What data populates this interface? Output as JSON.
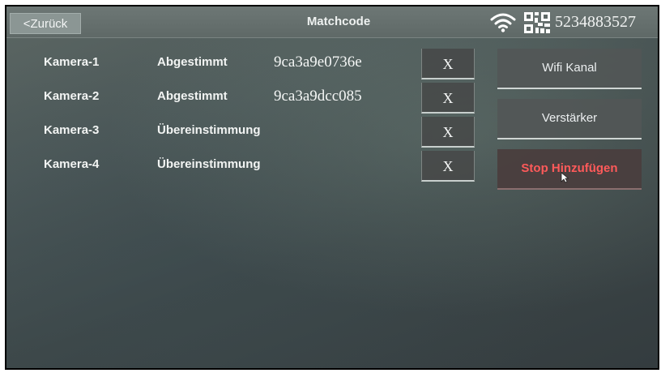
{
  "header": {
    "back_label": "<Zurück",
    "title": "Matchcode",
    "device_id": "5234883527",
    "icons": [
      "wifi-icon",
      "qr-code-icon"
    ]
  },
  "cameras": [
    {
      "name": "Kamera-1",
      "status": "Abgestimmt",
      "code": "9ca3a9e0736e",
      "remove_label": "X"
    },
    {
      "name": "Kamera-2",
      "status": "Abgestimmt",
      "code": "9ca3a9dcc085",
      "remove_label": "X"
    },
    {
      "name": "Kamera-3",
      "status": "Übereinstimmung",
      "code": "",
      "remove_label": "X"
    },
    {
      "name": "Kamera-4",
      "status": "Übereinstimmung",
      "code": "",
      "remove_label": "X"
    }
  ],
  "side_buttons": {
    "wifi_channel": "Wifi Kanal",
    "amplifier": "Verstärker",
    "stop_adding": "Stop Hinzufügen"
  },
  "colors": {
    "active_text": "#ff5a5a",
    "text": "#f2f4f3"
  }
}
